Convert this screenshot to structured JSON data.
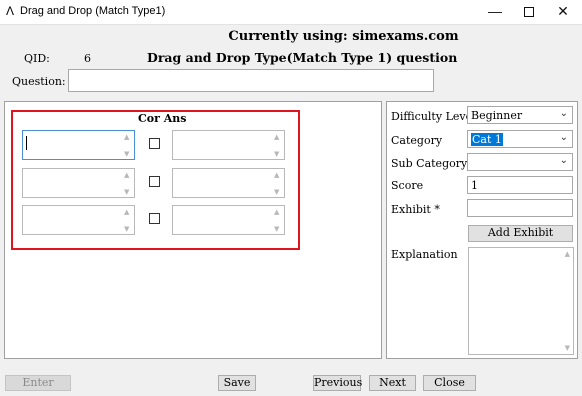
{
  "window": {
    "title": "Drag and Drop (Match Type1)",
    "app_icon": "A-caret-icon",
    "controls": {
      "minimize": "—",
      "close": "✕"
    }
  },
  "header": {
    "currently_using": "Currently using: simexams.com",
    "qid_label": "QID:",
    "qid_value": "6",
    "page_title": "Drag and Drop Type(Match Type 1) question",
    "question_label": "Question:",
    "question_value": ""
  },
  "match": {
    "heading": "Cor Ans",
    "rows": [
      {
        "left": "",
        "right": "",
        "checked": false
      },
      {
        "left": "",
        "right": "",
        "checked": false
      },
      {
        "left": "",
        "right": "",
        "checked": false
      }
    ],
    "highlight_color": "#e0141c"
  },
  "sidebar": {
    "difficulty_label": "Difficulty Level",
    "difficulty_value": "Beginner",
    "category_label": "Category",
    "category_value": "Cat 1",
    "subcategory_label": "Sub Category:",
    "subcategory_value": "",
    "score_label": "Score",
    "score_value": "1",
    "exhibit_label": "Exhibit  *",
    "exhibit_value": "",
    "add_exhibit_label": "Add Exhibit",
    "explanation_label": "Explanation",
    "explanation_value": ""
  },
  "footer": {
    "enter_label": "Enter",
    "save_label": "Save",
    "previous_label": "Previous",
    "next_label": "Next",
    "close_label": "Close"
  }
}
